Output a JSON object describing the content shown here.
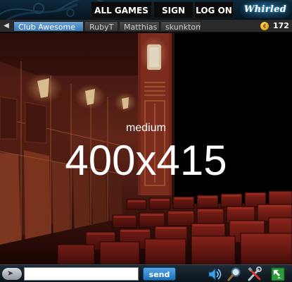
{
  "header": {
    "nav": {
      "all_games": "ALL GAMES",
      "sign_up": "SIGN UP",
      "log_on": "LOG ON"
    },
    "logo_text": "Whirled"
  },
  "tabs": [
    {
      "label": "Club Awesome",
      "active": true
    },
    {
      "label": "RubyT",
      "active": false
    },
    {
      "label": "Matthias",
      "active": false
    },
    {
      "label": "skunktom",
      "active": false
    }
  ],
  "coins": {
    "count": "172",
    "icon": "coin-icon"
  },
  "scene": {
    "quality": "medium",
    "dimensions": "400x415"
  },
  "chat": {
    "input_value": "",
    "send_label": "send"
  },
  "toolbar_icons": [
    "volume-icon",
    "zoom-icon",
    "build-tools-icon",
    "fullscreen-icon"
  ],
  "colors": {
    "accent_tab": "#4f8fc8",
    "header_bg": "#0d2a3d",
    "send_button": "#2e86cf",
    "wall": "#6b2418",
    "seat": "#8a1f18"
  }
}
